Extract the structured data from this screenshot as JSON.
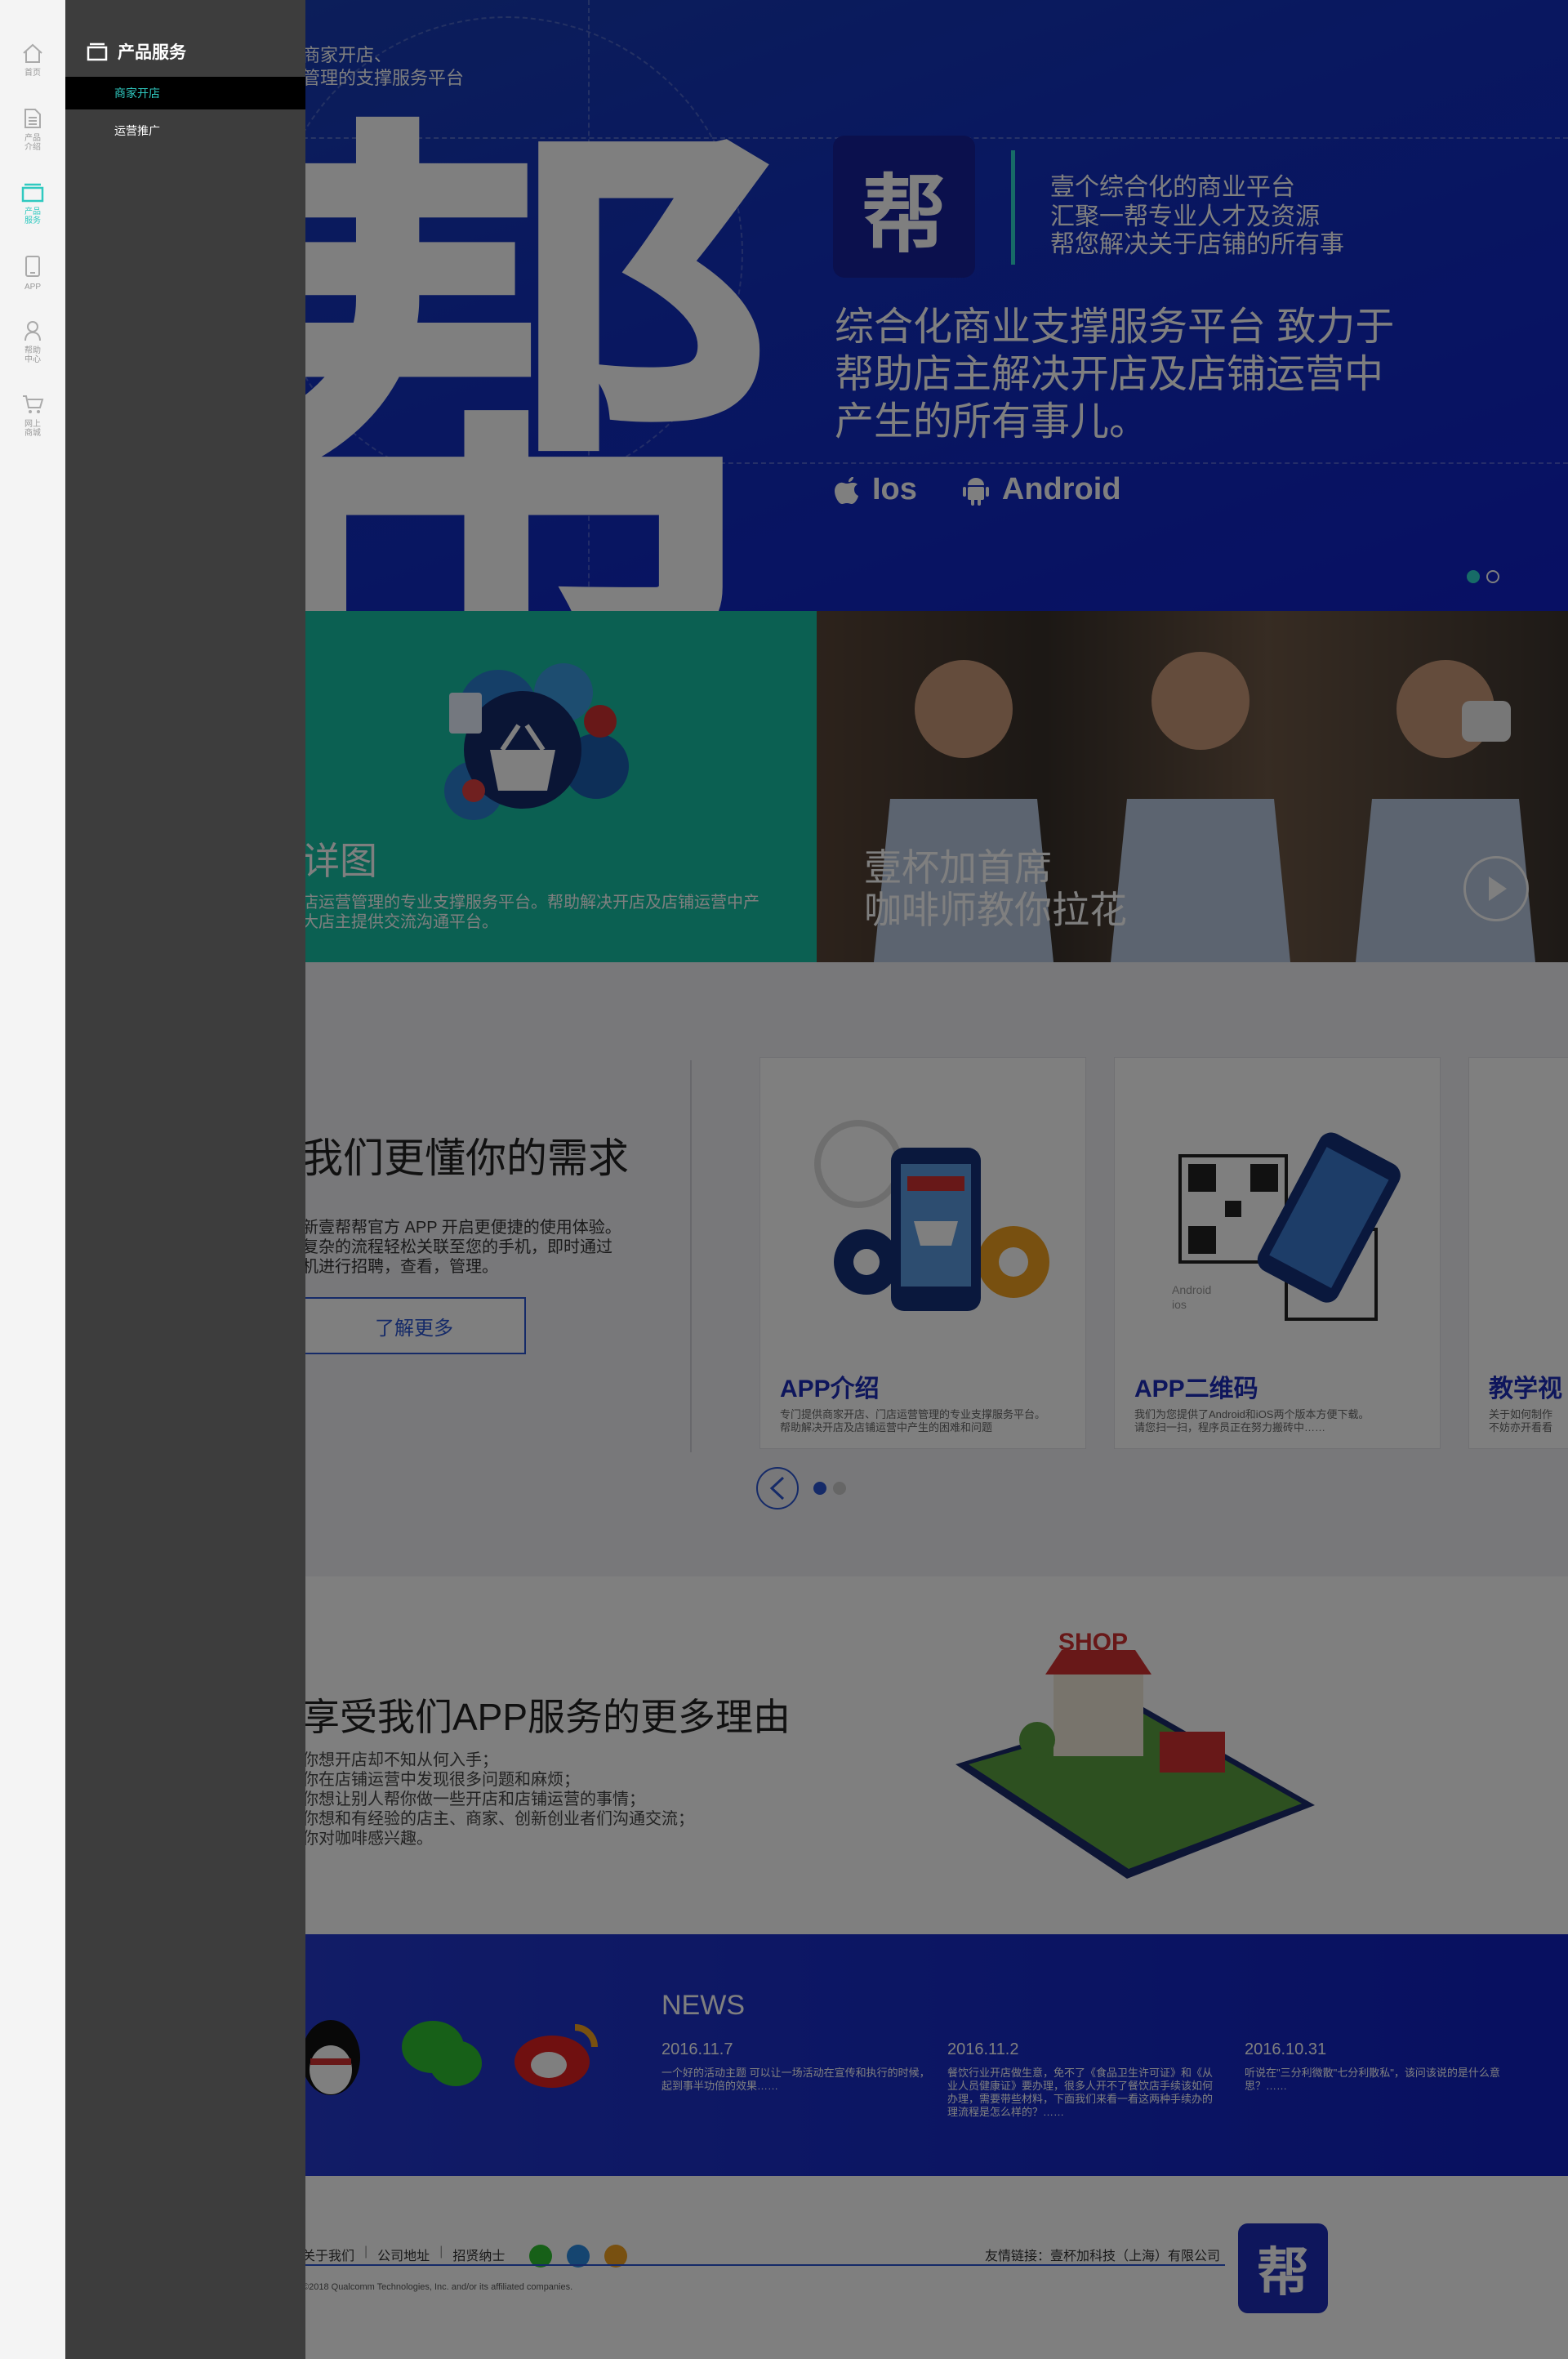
{
  "colors": {
    "accent": "#2fc9c0",
    "brand": "#1c2db8",
    "hero_bg": "#1230c0",
    "drawer_bg": "#3d3d3d",
    "rail_bg": "#f4f4f4",
    "feature_green": "#17c1a4"
  },
  "rail": {
    "items": [
      {
        "label": "首页",
        "icon": "home-icon"
      },
      {
        "label": "产品\n介绍",
        "icon": "document-icon"
      },
      {
        "label": "产品\n服务",
        "icon": "folder-icon",
        "active": true
      },
      {
        "label": "APP",
        "icon": "phone-icon"
      },
      {
        "label": "帮助\n中心",
        "icon": "user-icon"
      },
      {
        "label": "网上\n商城",
        "icon": "cart-icon"
      }
    ]
  },
  "drawer": {
    "title": "产品服务",
    "icon": "folder-icon",
    "items": [
      {
        "label": "商家开店",
        "active": true
      },
      {
        "label": "运营推广",
        "active": false
      }
    ]
  },
  "hero": {
    "topline1": "商家开店、",
    "topline2": "管理的支撑服务平台",
    "big_glyph": "帮",
    "logo_glyph": "帮",
    "tagline1": "壹个综合化的商业平台",
    "tagline2": "汇聚一帮专业人才及资源",
    "tagline3": "帮您解决关于店铺的所有事",
    "desc1": "综合化商业支撑服务平台 致力于",
    "desc2": "帮助店主解决开店及店铺运营中",
    "desc3": "产生的所有事儿。",
    "platform_ios": "Ios",
    "platform_android": "Android",
    "slide_current": 1,
    "slide_total": 2
  },
  "feature": {
    "left_title": "详图",
    "left_desc1": "店运营管理的专业支撑服务平台。帮助解决开店及店铺运营中产",
    "left_desc2": "大店主提供交流沟通平台。",
    "right_title1": "壹杯加首席",
    "right_title2": "咖啡师教你拉花"
  },
  "needs": {
    "title": "我们更懂你的需求",
    "line1": "新壹帮帮官方 APP 开启更便捷的使用体验。",
    "line2": "复杂的流程轻松关联至您的手机，即时通过",
    "line3": "机进行招聘，查看，管理。",
    "more_button": "了解更多",
    "cards": [
      {
        "title": "APP介绍",
        "desc1": "专门提供商家开店、门店运营管理的专业支撑服务平台。",
        "desc2": "帮助解决开店及店铺运营中产生的困难和问题"
      },
      {
        "title": "APP二维码",
        "desc1": "我们为您提供了Android和iOS两个版本方便下载。",
        "desc2": "请您扫一扫，程序员正在努力搬砖中……",
        "qr_label1": "Android",
        "qr_label2": "ios"
      },
      {
        "title": "教学视",
        "desc1": "关于如何制作",
        "desc2": "不妨亦开看看"
      }
    ],
    "page_current": 1,
    "page_total": 2
  },
  "reasons": {
    "title": "享受我们APP服务的更多理由",
    "items": [
      "你想开店却不知从何入手；",
      "你在店铺运营中发现很多问题和麻烦；",
      "你想让别人帮你做一些开店和店铺运营的事情；",
      "你想和有经验的店主、商家、创新创业者们沟通交流；",
      "你对咖啡感兴趣。"
    ],
    "shop_sign": "SHOP"
  },
  "news": {
    "heading": "NEWS",
    "items": [
      {
        "date": "2016.11.7",
        "text": "一个好的活动主题 可以让一场活动在宣传和执行的时候，起到事半功倍的效果……"
      },
      {
        "date": "2016.11.2",
        "text": "餐饮行业开店做生意，免不了《食品卫生许可证》和《从业人员健康证》要办理，很多人开不了餐饮店手续该如何办理，需要带些材料，下面我们来看一看这两种手续办的理流程是怎么样的？……"
      },
      {
        "date": "2016.10.31",
        "text": "听说在\"三分利微散\"七分利散私\"，该问该说的是什么意思？……"
      }
    ],
    "social_icons": [
      "qq-icon",
      "wechat-icon",
      "weibo-icon"
    ]
  },
  "footer": {
    "links": [
      "关于我们",
      "公司地址",
      "招贤纳士"
    ],
    "friend_link": "友情链接：壹杯加科技（上海）有限公司",
    "copyright": "©2018 Qualcomm Technologies, Inc. and/or its affiliated companies.",
    "logo_glyph": "帮"
  }
}
